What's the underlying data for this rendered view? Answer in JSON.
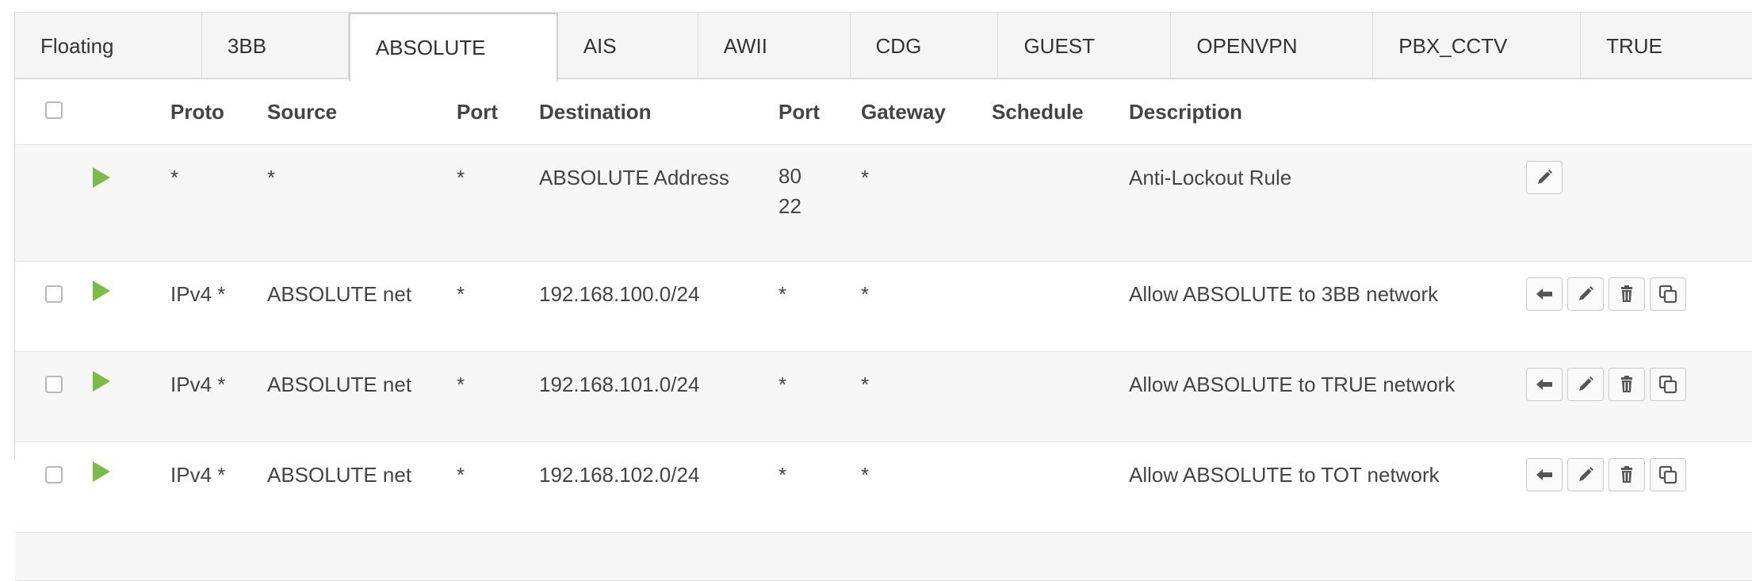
{
  "tabs": [
    {
      "label": "Floating"
    },
    {
      "label": "3BB"
    },
    {
      "label": "ABSOLUTE"
    },
    {
      "label": "AIS"
    },
    {
      "label": "AWII"
    },
    {
      "label": "CDG"
    },
    {
      "label": "GUEST"
    },
    {
      "label": "OPENVPN"
    },
    {
      "label": "PBX_CCTV"
    },
    {
      "label": "TRUE"
    }
  ],
  "active_tab": "ABSOLUTE",
  "table": {
    "headers": {
      "proto": "Proto",
      "source": "Source",
      "port": "Port",
      "destination": "Destination",
      "dport": "Port",
      "gateway": "Gateway",
      "schedule": "Schedule",
      "description": "Description"
    },
    "rows": [
      {
        "proto": "*",
        "source": "*",
        "port": "*",
        "destination": "ABSOLUTE Address",
        "dport_lines": [
          "80",
          "22"
        ],
        "gateway": "*",
        "schedule": "",
        "description": "Anti-Lockout Rule"
      },
      {
        "proto": "IPv4 *",
        "source": "ABSOLUTE net",
        "port": "*",
        "destination": "192.168.100.0/24",
        "dport": "*",
        "gateway": "*",
        "schedule": "",
        "description": "Allow ABSOLUTE to 3BB network"
      },
      {
        "proto": "IPv4 *",
        "source": "ABSOLUTE net",
        "port": "*",
        "destination": "192.168.101.0/24",
        "dport": "*",
        "gateway": "*",
        "schedule": "",
        "description": "Allow ABSOLUTE to TRUE network"
      },
      {
        "proto": "IPv4 *",
        "source": "ABSOLUTE net",
        "port": "*",
        "destination": "192.168.102.0/24",
        "dport": "*",
        "gateway": "*",
        "schedule": "",
        "description": "Allow ABSOLUTE to TOT network"
      }
    ]
  },
  "colors": {
    "pass_icon": "#7cbb44",
    "tab_bg": "#f5f5f5",
    "border": "#dcdcdc"
  },
  "icons": {
    "pass": "play-icon",
    "move": "arrow-left-icon",
    "edit": "pencil-icon",
    "delete": "trash-icon",
    "copy": "copy-icon"
  }
}
